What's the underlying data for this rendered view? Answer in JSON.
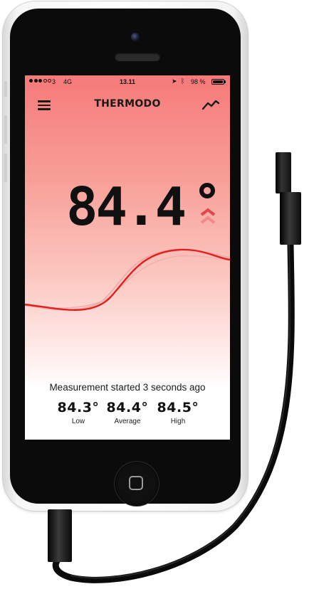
{
  "status_bar": {
    "carrier": "3",
    "network": "4G",
    "time": "13.11",
    "battery": "98 %"
  },
  "header": {
    "title": "THERMODO"
  },
  "reading": {
    "value": "84.4",
    "trend": "rising"
  },
  "measurement": {
    "text": "Measurement started 3 seconds ago"
  },
  "stats": [
    {
      "value": "84.3°",
      "label": "Low"
    },
    {
      "value": "84.4°",
      "label": "Average"
    },
    {
      "value": "84.5°",
      "label": "High"
    }
  ],
  "icons": {
    "menu": "hamburger-menu-icon",
    "trend": "line-chart-icon",
    "rising": "double-chevron-up-icon"
  },
  "colors": {
    "accent": "#e02020",
    "gradient_top": "#f57a7a",
    "text": "#111111"
  }
}
